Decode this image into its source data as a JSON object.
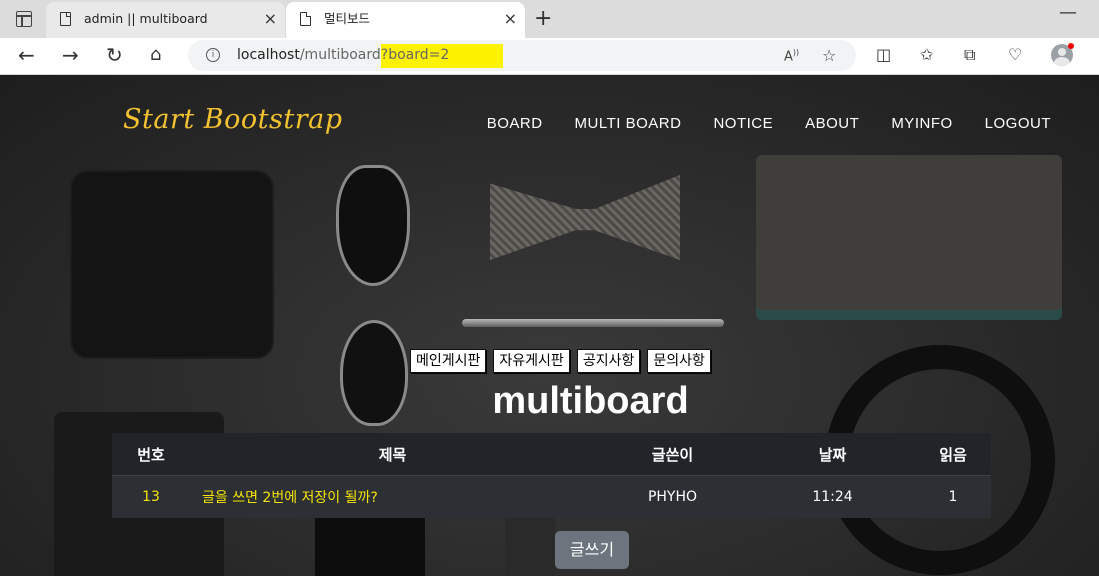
{
  "browser": {
    "tabs": [
      {
        "title": "admin || multiboard",
        "active": false
      },
      {
        "title": "멀티보드",
        "active": true
      }
    ],
    "new_tab": "+",
    "minimize": "—",
    "url": {
      "host": "localhost",
      "path": "/multiboard",
      "query": "?board=2"
    },
    "info_glyph": "i",
    "icons": [
      "back-icon",
      "forward-icon",
      "reload-icon",
      "home-icon",
      "read-aloud-icon",
      "favorite-icon",
      "split-screen-icon",
      "favorites-icon",
      "collections-icon",
      "browser-essentials-icon",
      "profile-icon"
    ]
  },
  "site": {
    "brand": "Start Bootstrap",
    "nav": [
      "BOARD",
      "MULTI BOARD",
      "NOTICE",
      "ABOUT",
      "MYINFO",
      "LOGOUT"
    ]
  },
  "board_links": [
    "메인게시판",
    "자유게시판",
    "공지사항",
    "문의사항"
  ],
  "page_title": "multiboard",
  "table": {
    "headers": [
      "번호",
      "제목",
      "글쓴이",
      "날짜",
      "읽음"
    ],
    "rows": [
      {
        "num": "13",
        "title": "글을 쓰면 2번에 저장이 될까?",
        "writer": "PHYHO",
        "date": "11:24",
        "reads": "1"
      }
    ]
  },
  "write_button": "글쓰기",
  "colors": {
    "brand": "#f2c230",
    "highlight": "#fff200",
    "link_yellow": "#f5e400",
    "button_gray": "#6c757d",
    "table_dark": "#212529"
  }
}
